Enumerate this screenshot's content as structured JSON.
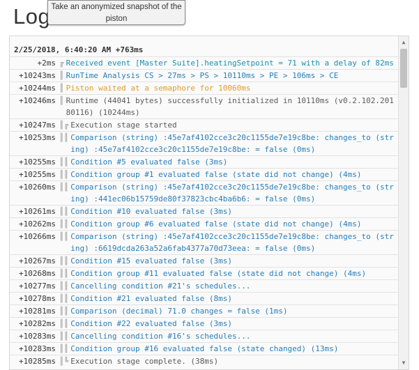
{
  "page": {
    "title": "Logs"
  },
  "tooltip": {
    "text": "Take an anonymized snapshot of the piston"
  },
  "log": {
    "header": "2/25/2018, 6:40:20 AM +763ms",
    "rows": [
      {
        "ts": "+2ms",
        "bars": "╔",
        "msg": "Received event [Master Suite].heatingSetpoint = 71 with a delay of 82ms",
        "color": "teal"
      },
      {
        "ts": "+10243ms",
        "bars": "║",
        "msg": "RunTime Analysis CS > 27ms > PS > 10110ms > PE > 106ms > CE",
        "color": "blue"
      },
      {
        "ts": "+10244ms",
        "bars": "║",
        "msg": "Piston waited at a semaphore for 10060ms",
        "color": "orange"
      },
      {
        "ts": "+10246ms",
        "bars": "║",
        "msg": "Runtime (44041 bytes) successfully initialized in 10110ms (v0.2.102.20180116) (10244ms)",
        "color": "gray"
      },
      {
        "ts": "+10247ms",
        "bars": "║╔",
        "msg": "Execution stage started",
        "color": "gray"
      },
      {
        "ts": "+10253ms",
        "bars": "║║",
        "msg": "Comparison (string) :45e7af4102cce3c20c1155de7e19c8be: changes_to (string) :45e7af4102cce3c20c1155de7e19c8be: = false (0ms)",
        "color": "blue"
      },
      {
        "ts": "+10255ms",
        "bars": "║║",
        "msg": "Condition #5 evaluated false (3ms)",
        "color": "blue"
      },
      {
        "ts": "+10255ms",
        "bars": "║║",
        "msg": "Condition group #1 evaluated false (state did not change) (4ms)",
        "color": "blue"
      },
      {
        "ts": "+10260ms",
        "bars": "║║",
        "msg": "Comparison (string) :45e7af4102cce3c20c1155de7e19c8be: changes_to (string) :441ec06b15759de80f37823cbc4ba6b6: = false (0ms)",
        "color": "blue"
      },
      {
        "ts": "+10261ms",
        "bars": "║║",
        "msg": "Condition #10 evaluated false (3ms)",
        "color": "blue"
      },
      {
        "ts": "+10262ms",
        "bars": "║║",
        "msg": "Condition group #6 evaluated false (state did not change) (4ms)",
        "color": "blue"
      },
      {
        "ts": "+10266ms",
        "bars": "║║",
        "msg": "Comparison (string) :45e7af4102cce3c20c1155de7e19c8be: changes_to (string) :6619dcda263a52a6fab4377a70d73eea: = false (0ms)",
        "color": "blue"
      },
      {
        "ts": "+10267ms",
        "bars": "║║",
        "msg": "Condition #15 evaluated false (3ms)",
        "color": "blue"
      },
      {
        "ts": "+10268ms",
        "bars": "║║",
        "msg": "Condition group #11 evaluated false (state did not change) (4ms)",
        "color": "blue"
      },
      {
        "ts": "+10277ms",
        "bars": "║║",
        "msg": "Cancelling condition #21's schedules...",
        "color": "blue"
      },
      {
        "ts": "+10278ms",
        "bars": "║║",
        "msg": "Condition #21 evaluated false (8ms)",
        "color": "blue"
      },
      {
        "ts": "+10281ms",
        "bars": "║║",
        "msg": "Comparison (decimal) 71.0 changes = false (1ms)",
        "color": "blue"
      },
      {
        "ts": "+10282ms",
        "bars": "║║",
        "msg": "Condition #22 evaluated false (3ms)",
        "color": "blue"
      },
      {
        "ts": "+10283ms",
        "bars": "║║",
        "msg": "Cancelling condition #16's schedules...",
        "color": "blue"
      },
      {
        "ts": "+10283ms",
        "bars": "║║",
        "msg": "Condition group #16 evaluated false (state changed) (13ms)",
        "color": "blue"
      },
      {
        "ts": "+10285ms",
        "bars": "║╚",
        "msg": "Execution stage complete. (38ms)",
        "color": "gray"
      }
    ]
  },
  "colors": {
    "blue": "#2a7db8",
    "orange": "#e39b26",
    "gray": "#5a5a5a",
    "teal": "#1b8fb0"
  }
}
